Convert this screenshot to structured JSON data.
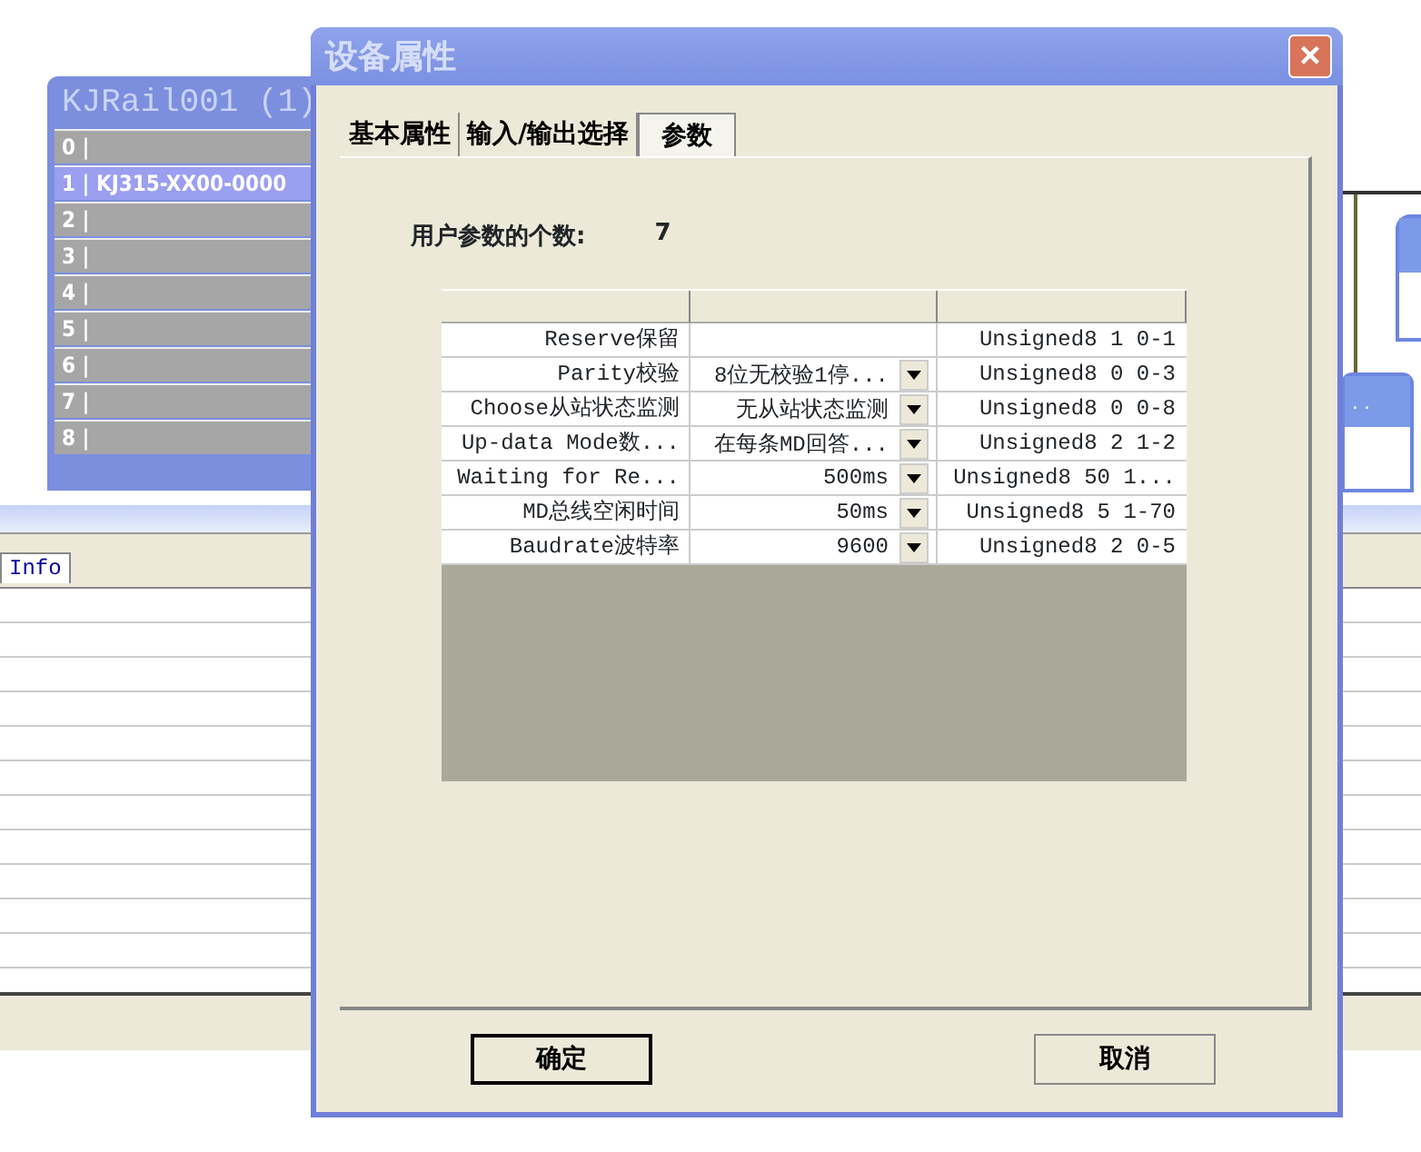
{
  "back_window": {
    "title": "KJRail001 (1)",
    "rows": [
      {
        "label": "0 |",
        "selected": false
      },
      {
        "label": "1 | KJ315-XX00-0000",
        "selected": true
      },
      {
        "label": "2 |",
        "selected": false
      },
      {
        "label": "3 |",
        "selected": false
      },
      {
        "label": "4 |",
        "selected": false
      },
      {
        "label": "5 |",
        "selected": false
      },
      {
        "label": "6 |",
        "selected": false
      },
      {
        "label": "7 |",
        "selected": false
      },
      {
        "label": "8 |",
        "selected": false
      }
    ]
  },
  "bottom_panel": {
    "tabs": [
      {
        "label": "Info",
        "selected": true
      }
    ]
  },
  "side_window": {
    "title": ". ."
  },
  "dialog": {
    "title": "设备属性",
    "close": "×",
    "tabs": [
      {
        "label": "基本属性",
        "selected": false
      },
      {
        "label": "输入/输出选择",
        "selected": false
      },
      {
        "label": "参数",
        "selected": true
      }
    ],
    "count_label": "用户参数的个数:",
    "count_value": "7",
    "grid": {
      "rows": [
        {
          "name": "Reserve保留",
          "kind": "plain",
          "value": "",
          "type": "Unsigned8 1 0-1"
        },
        {
          "name": "Parity校验",
          "kind": "combo",
          "value": "8位无校验1停...",
          "type": "Unsigned8 0 0-3"
        },
        {
          "name": "Choose从站状态监测",
          "kind": "combo",
          "value": "无从站状态监测",
          "type": "Unsigned8 0 0-8"
        },
        {
          "name": "Up-data Mode数...",
          "kind": "combo",
          "value": "在每条MD回答...",
          "type": "Unsigned8 2 1-2"
        },
        {
          "name": "Waiting for Re...",
          "kind": "combo",
          "value": "500ms",
          "type": "Unsigned8 50 1..."
        },
        {
          "name": "MD总线空闲时间",
          "kind": "combo",
          "value": "50ms",
          "type": "Unsigned8 5 1-70"
        },
        {
          "name": "Baudrate波特率",
          "kind": "combo",
          "value": "9600",
          "type": "Unsigned8 2 0-5"
        }
      ]
    },
    "buttons": [
      {
        "label": "确定",
        "default": true
      },
      {
        "label": "取消",
        "default": false
      }
    ]
  }
}
